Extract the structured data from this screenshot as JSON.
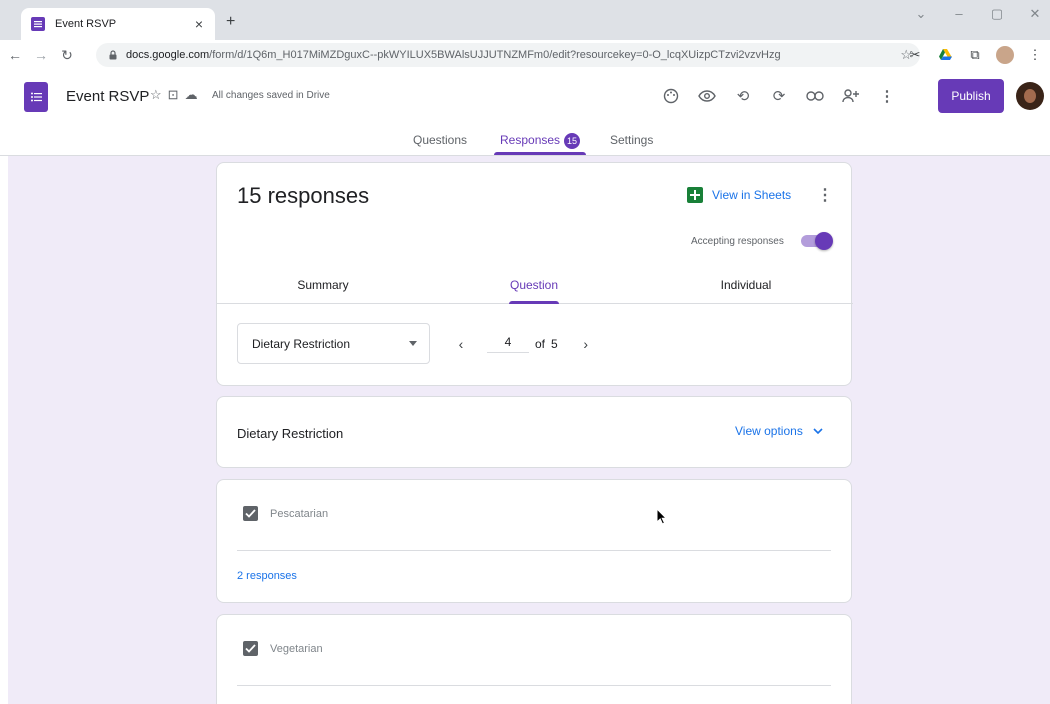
{
  "browser": {
    "tab_title": "Event RSVP",
    "new_tab_label": "+",
    "url_host": "docs.google.com",
    "url_path": "/form/d/1Q6m_H017MiMZDguxC--pkWYILUX5BWAlsUJJUTNZMFm0/edit?resourcekey=0-O_lcqXUizpCTzvi2vzvHzg"
  },
  "header": {
    "title": "Event RSVP",
    "save_status": "All changes saved in Drive",
    "publish_label": "Publish"
  },
  "main_tabs": {
    "questions": "Questions",
    "responses": "Responses",
    "responses_count": "15",
    "settings": "Settings"
  },
  "summary_card": {
    "title": "15 responses",
    "view_in_sheets": "View in Sheets",
    "accepting_label": "Accepting responses",
    "subtabs": [
      "Summary",
      "Question",
      "Individual"
    ],
    "selected_question": "Dietary Restriction",
    "pager_current": "4",
    "pager_of": "of",
    "pager_total": "5"
  },
  "question_card": {
    "title": "Dietary Restriction",
    "view_options": "View options"
  },
  "answers": [
    {
      "label": "Pescatarian",
      "count": "2 responses"
    },
    {
      "label": "Vegetarian"
    }
  ],
  "colors": {
    "accent": "#673ab7",
    "link": "#1a73e8",
    "background": "#f0ebf8"
  }
}
